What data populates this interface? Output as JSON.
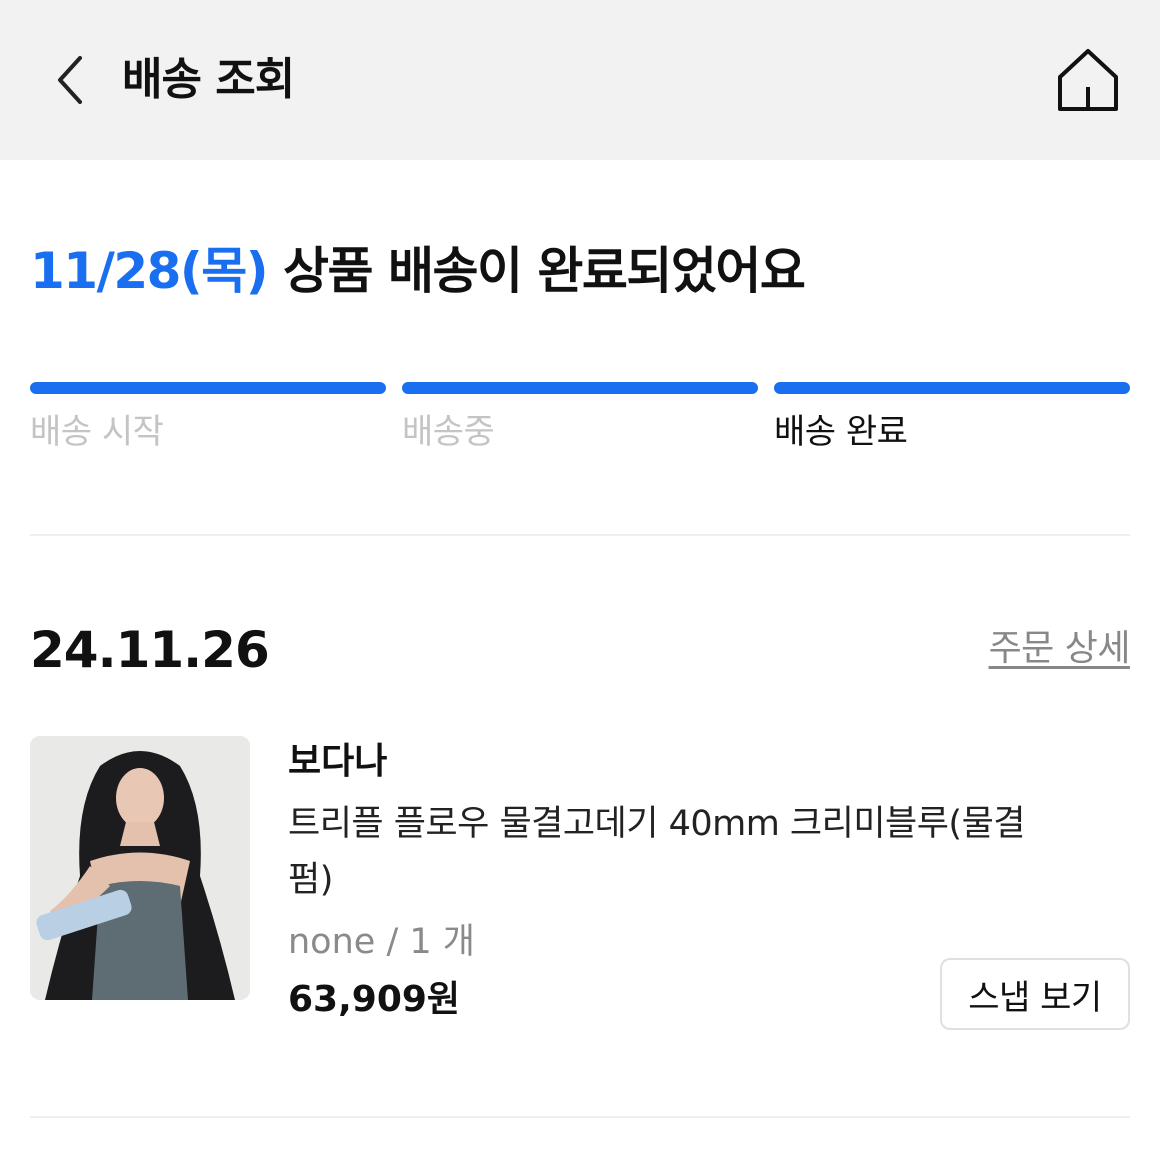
{
  "header": {
    "title": "배송 조회",
    "back_icon": "chevron-left-icon",
    "home_icon": "home-icon"
  },
  "status": {
    "date": "11/28(목)",
    "message": "상품 배송이 완료되었어요"
  },
  "steps": [
    {
      "label": "배송 시작",
      "active": false
    },
    {
      "label": "배송중",
      "active": false
    },
    {
      "label": "배송 완료",
      "active": true
    }
  ],
  "order": {
    "date": "24.11.26",
    "detail_link": "주문 상세",
    "item": {
      "brand": "보다나",
      "name_line1": "트리플 플로우 물결고데기 40mm 크리미블루(물결",
      "name_line2": "펌)",
      "option": "none / 1 개",
      "price": "63,909원",
      "snap_button": "스냅 보기"
    }
  },
  "colors": {
    "accent": "#1a6ef0",
    "header_bg": "#f2f2f2",
    "inactive_text": "#c4c4c4"
  }
}
